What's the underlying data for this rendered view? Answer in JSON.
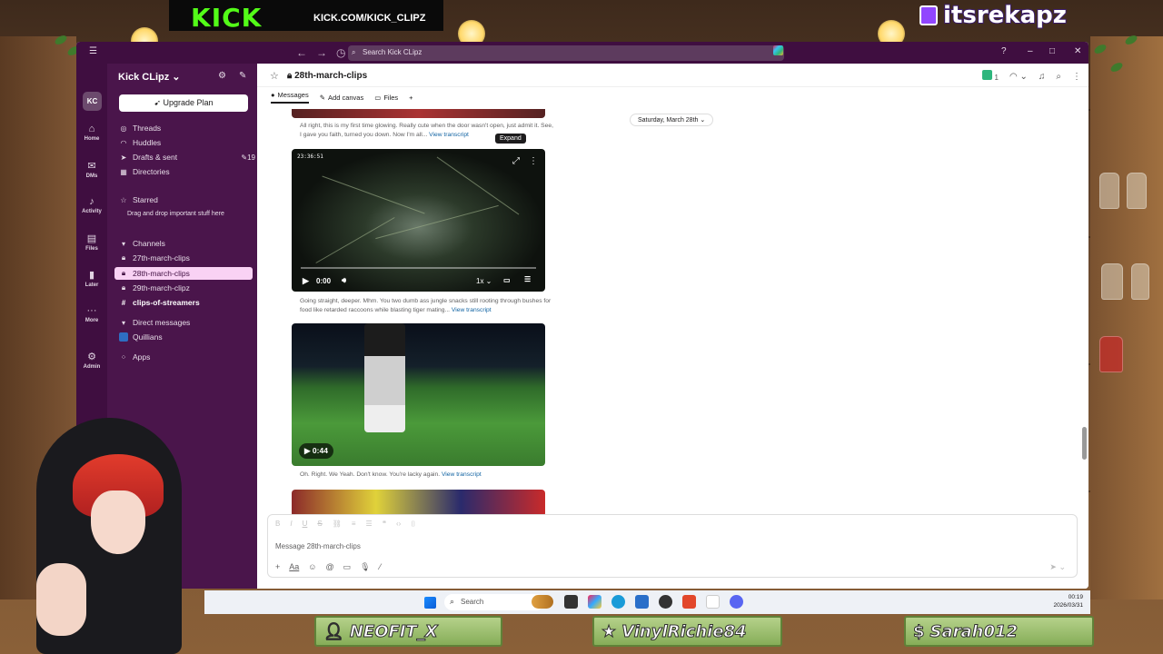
{
  "overlay": {
    "kick_logo": "KICK",
    "kick_url": "KICK.COM/KICK_CLIPZ",
    "twitch_handle": "itsrekapz",
    "subs": [
      {
        "icon": "person-icon",
        "name": "NEOFIT_X"
      },
      {
        "icon": "star-icon",
        "name": "VinylRichie84"
      },
      {
        "icon": "dollar-icon",
        "name": "Sarah012"
      }
    ]
  },
  "titlebar": {
    "search_placeholder": "Search Kick CLipz"
  },
  "rail": {
    "workspace_initials": "KC",
    "items": [
      {
        "icon": "home-icon",
        "label": "Home"
      },
      {
        "icon": "dms-icon",
        "label": "DMs"
      },
      {
        "icon": "bell-icon",
        "label": "Activity"
      },
      {
        "icon": "files-icon",
        "label": "Files"
      },
      {
        "icon": "bookmark-icon",
        "label": "Later"
      },
      {
        "icon": "ellipsis-icon",
        "label": "More"
      },
      {
        "icon": "gear-icon",
        "label": "Admin"
      }
    ]
  },
  "sidebar": {
    "workspace_name": "Kick CLipz",
    "upgrade_label": "Upgrade Plan",
    "nav": [
      {
        "label": "Threads"
      },
      {
        "label": "Huddles"
      },
      {
        "label": "Drafts & sent",
        "badge": "19"
      },
      {
        "label": "Directories"
      }
    ],
    "starred_label": "Starred",
    "starred_hint": "Drag and drop important stuff here",
    "channels_label": "Channels",
    "channels": [
      {
        "label": "27th-march-clips"
      },
      {
        "label": "28th-march-clips"
      },
      {
        "label": "29th-march-clipz"
      },
      {
        "label": "clips-of-streamers"
      }
    ],
    "dm_label": "Direct messages",
    "dms": [
      {
        "label": "Quillians"
      }
    ],
    "apps_label": "Apps"
  },
  "channel": {
    "title": "28th-march-clips",
    "huddle_count": "1",
    "tabs": [
      {
        "label": "Messages"
      },
      {
        "label": "Add canvas"
      },
      {
        "label": "Files"
      }
    ],
    "date_divider": "Saturday, March 28th",
    "messages": [
      {
        "caption": "All right, this is my first time glowing. Really cute when the door wasn't open, just admit it. See, I gave you faith, turned you down. Now I'm all...",
        "link": "View transcript"
      },
      {
        "caption": "Going straight, deeper. Mhm. You two dumb ass jungle snacks still rooting through bushes for food like retarded raccoons while blasting tiger mating...",
        "link": "View transcript",
        "video_time": "0:00",
        "video_stamp": "23:36:51",
        "speed": "1x",
        "tooltip": "Expand"
      },
      {
        "caption": "Oh. Right. We Yeah. Don't know. You're lacky again.",
        "link": "View transcript",
        "video_duration": "0:44"
      }
    ]
  },
  "composer": {
    "placeholder": "Message 28th-march-clips"
  },
  "taskbar": {
    "search_label": "Search",
    "time": "00:19",
    "date": "2026/03/31"
  }
}
